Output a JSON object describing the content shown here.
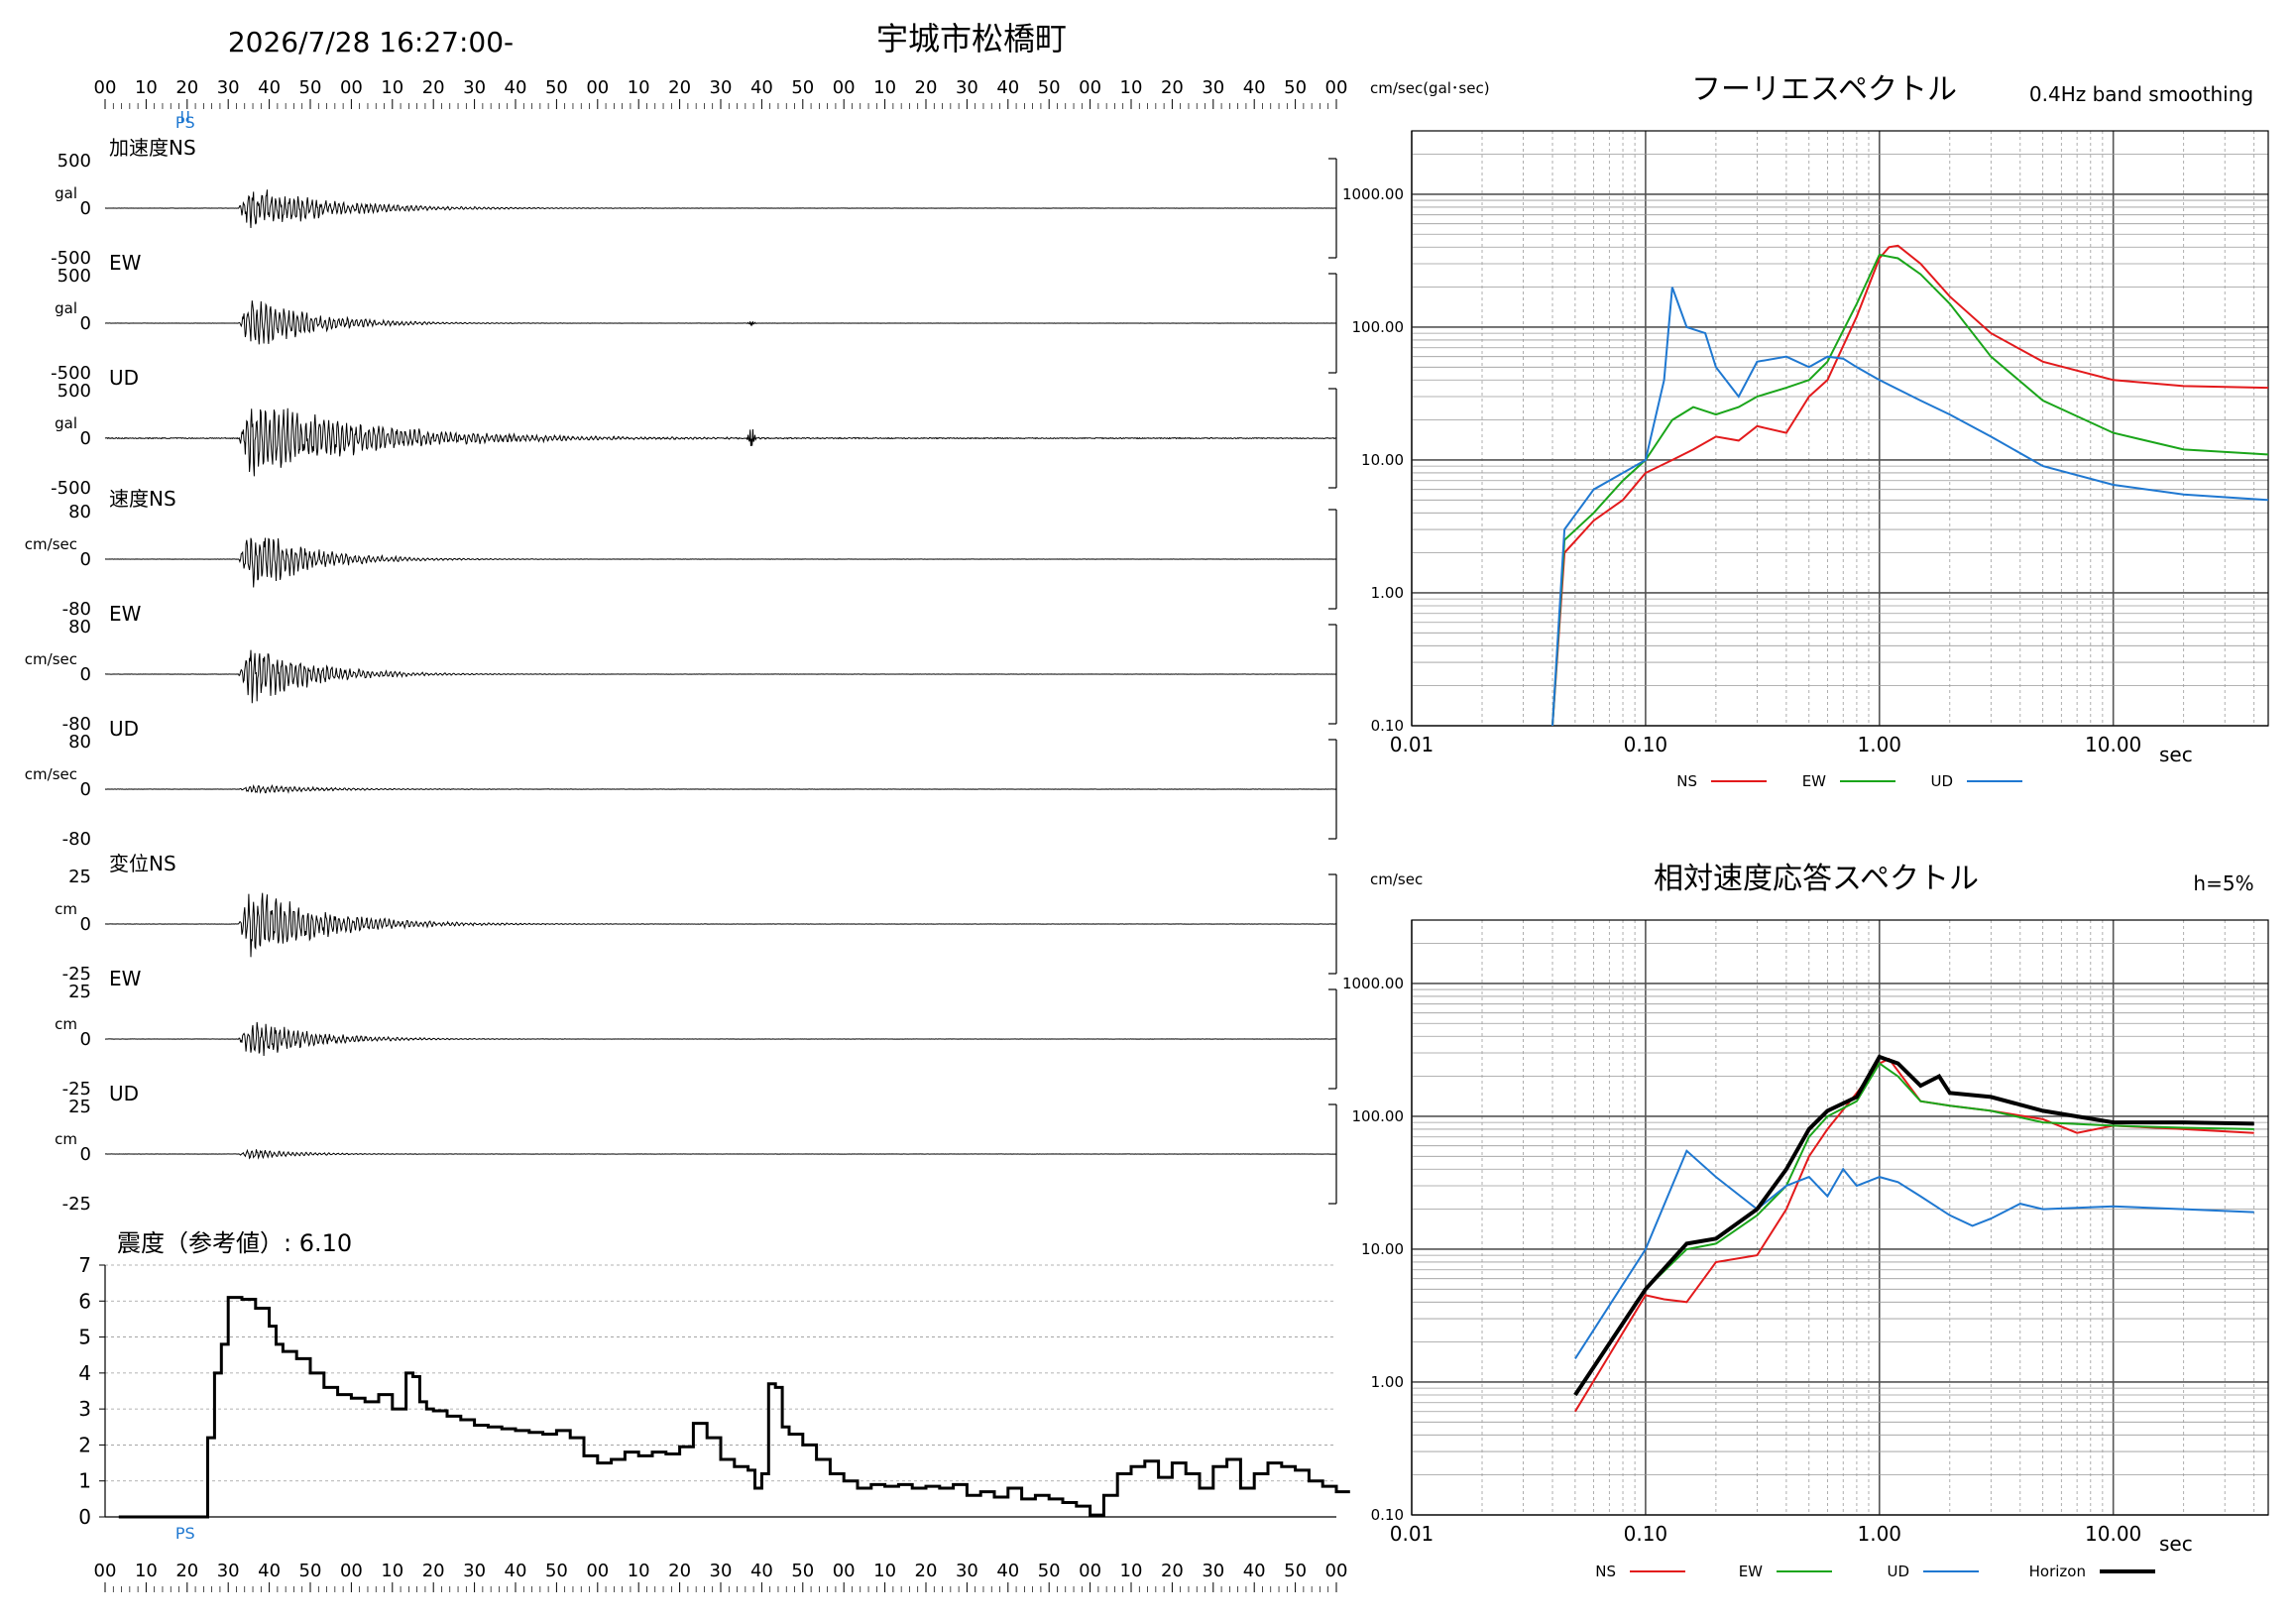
{
  "header": {
    "datetime": "2026/7/28 16:27:00-",
    "station": "宇城市松橋町"
  },
  "time_axis_labels": [
    "00",
    "10",
    "20",
    "30",
    "40",
    "50",
    "00",
    "10",
    "20",
    "30",
    "40",
    "50",
    "00",
    "10",
    "20",
    "30",
    "40",
    "50",
    "00",
    "10",
    "20",
    "30",
    "40",
    "50",
    "00",
    "10",
    "20",
    "30",
    "40",
    "50",
    "00"
  ],
  "ps_marker": "PS",
  "waveform_panels": [
    {
      "group": "加速度",
      "label": "加速度NS",
      "unit": "gal",
      "max": "500",
      "zero": "0",
      "min": "-500",
      "peak": 0.6,
      "decay": 0.09,
      "impulses": [],
      "noise": 0.004
    },
    {
      "group": "加速度",
      "label": "EW",
      "unit": "gal",
      "max": "500",
      "zero": "0",
      "min": "-500",
      "peak": 0.75,
      "decay": 0.12,
      "impulses": [
        [
          50,
          0.05
        ]
      ],
      "noise": 0.003
    },
    {
      "group": "加速度",
      "label": "UD",
      "unit": "gal",
      "max": "500",
      "zero": "0",
      "min": "-500",
      "peak": 0.9,
      "decay": 0.06,
      "impulses": [
        [
          50,
          0.25
        ]
      ],
      "noise": 0.02
    },
    {
      "group": "速度",
      "label": "速度NS",
      "unit": "cm/sec",
      "max": "80",
      "zero": "0",
      "min": "-80",
      "peak": 0.85,
      "decay": 0.12,
      "impulses": [],
      "noise": 0.004
    },
    {
      "group": "速度",
      "label": "EW",
      "unit": "cm/sec",
      "max": "80",
      "zero": "0",
      "min": "-80",
      "peak": 0.85,
      "decay": 0.12,
      "impulses": [],
      "noise": 0.004
    },
    {
      "group": "速度",
      "label": "UD",
      "unit": "cm/sec",
      "max": "80",
      "zero": "0",
      "min": "-80",
      "peak": 0.12,
      "decay": 0.1,
      "impulses": [],
      "noise": 0.006
    },
    {
      "group": "変位",
      "label": "変位NS",
      "unit": "cm",
      "max": "25",
      "zero": "0",
      "min": "-25",
      "peak": 0.95,
      "decay": 0.1,
      "impulses": [],
      "noise": 0.005
    },
    {
      "group": "変位",
      "label": "EW",
      "unit": "cm",
      "max": "25",
      "zero": "0",
      "min": "-25",
      "peak": 0.55,
      "decay": 0.12,
      "impulses": [],
      "noise": 0.004
    },
    {
      "group": "変位",
      "label": "UD",
      "unit": "cm",
      "max": "25",
      "zero": "0",
      "min": "-25",
      "peak": 0.15,
      "decay": 0.15,
      "impulses": [],
      "noise": 0.004
    }
  ],
  "intensity_panel": {
    "title": "震度（参考値）: 6.10",
    "yticks": [
      "7",
      "6",
      "5",
      "4",
      "3",
      "2",
      "1",
      "0"
    ]
  },
  "chart_data": [
    {
      "type": "line",
      "title": "",
      "ylabel": "",
      "xlabel": "",
      "ylim": [
        0,
        7
      ],
      "xlim": [
        0,
        180
      ],
      "series": [
        {
          "x": [
            0,
            6,
            12,
            13,
            14,
            15,
            16,
            17,
            18,
            20,
            22,
            23,
            24,
            26,
            28,
            30,
            32,
            34,
            36,
            38,
            40,
            42,
            43,
            44,
            45,
            46,
            48,
            50,
            52,
            54,
            56,
            58,
            60,
            62,
            64,
            66,
            68,
            70,
            72,
            74,
            76,
            78,
            80,
            82,
            84,
            86,
            88,
            90,
            92,
            93,
            94,
            95,
            96,
            97,
            98,
            100,
            102,
            104,
            106,
            108,
            110,
            112,
            114,
            116,
            118,
            120,
            122,
            124,
            126,
            128,
            130,
            132,
            134,
            136,
            138,
            140,
            142,
            144,
            146,
            148,
            150,
            152,
            154,
            156,
            158,
            160,
            162,
            164,
            166,
            168,
            170,
            172,
            174,
            176,
            178,
            180
          ],
          "y": [
            0,
            0,
            0,
            2.2,
            4.0,
            4.8,
            6.1,
            6.1,
            6.05,
            5.8,
            5.3,
            4.8,
            4.6,
            4.4,
            4.0,
            3.6,
            3.4,
            3.3,
            3.2,
            3.4,
            3.0,
            4.0,
            3.9,
            3.2,
            3.0,
            2.95,
            2.8,
            2.7,
            2.55,
            2.5,
            2.45,
            2.4,
            2.35,
            2.3,
            2.4,
            2.2,
            1.7,
            1.5,
            1.6,
            1.8,
            1.7,
            1.8,
            1.75,
            1.95,
            2.6,
            2.2,
            1.6,
            1.4,
            1.3,
            0.8,
            1.2,
            3.7,
            3.6,
            2.5,
            2.3,
            2.0,
            1.6,
            1.2,
            1.0,
            0.8,
            0.9,
            0.85,
            0.9,
            0.8,
            0.85,
            0.8,
            0.9,
            0.6,
            0.7,
            0.55,
            0.8,
            0.5,
            0.6,
            0.5,
            0.4,
            0.3,
            0.05,
            0.6,
            1.2,
            1.4,
            1.55,
            1.1,
            1.5,
            1.2,
            0.8,
            1.4,
            1.6,
            0.8,
            1.2,
            1.5,
            1.4,
            1.3,
            1.0,
            0.85,
            0.7,
            0.7
          ]
        }
      ]
    },
    {
      "type": "line",
      "title": "フーリエスペクトル",
      "subtitle": "0.4Hz band smoothing",
      "ylabel": "cm/sec(gal･sec)",
      "xlabel": "sec",
      "xscale": "log",
      "yscale": "log",
      "xlim": [
        0.01,
        46
      ],
      "ylim": [
        0.1,
        3000
      ],
      "x_ticks": [
        "0.01",
        "0.10",
        "1.00",
        "10.00"
      ],
      "y_ticks": [
        "0.10",
        "1.00",
        "10.00",
        "100.00",
        "1000.00"
      ],
      "legend_position": "bottom",
      "series": [
        {
          "name": "NS",
          "color": "#e31a1c",
          "x": [
            0.04,
            0.045,
            0.06,
            0.08,
            0.1,
            0.13,
            0.16,
            0.2,
            0.25,
            0.3,
            0.4,
            0.5,
            0.6,
            0.8,
            1.0,
            1.1,
            1.2,
            1.5,
            2,
            3,
            5,
            10,
            20,
            46
          ],
          "y": [
            0.1,
            2,
            3.5,
            5,
            8,
            10,
            12,
            15,
            14,
            18,
            16,
            30,
            40,
            120,
            330,
            400,
            410,
            300,
            170,
            90,
            55,
            40,
            36,
            35
          ]
        },
        {
          "name": "EW",
          "color": "#1aa51a",
          "x": [
            0.04,
            0.045,
            0.06,
            0.08,
            0.1,
            0.13,
            0.16,
            0.2,
            0.25,
            0.3,
            0.4,
            0.5,
            0.6,
            0.8,
            1.0,
            1.2,
            1.5,
            2,
            3,
            5,
            10,
            20,
            46
          ],
          "y": [
            0.1,
            2.5,
            4,
            7,
            10,
            20,
            25,
            22,
            25,
            30,
            35,
            40,
            55,
            150,
            350,
            330,
            250,
            150,
            60,
            28,
            16,
            12,
            11
          ]
        },
        {
          "name": "UD",
          "color": "#1f78d1",
          "x": [
            0.04,
            0.045,
            0.06,
            0.08,
            0.1,
            0.12,
            0.13,
            0.15,
            0.18,
            0.2,
            0.25,
            0.3,
            0.4,
            0.5,
            0.6,
            0.7,
            0.8,
            1.0,
            1.5,
            2,
            3,
            5,
            10,
            20,
            46
          ],
          "y": [
            0.1,
            3,
            6,
            8,
            10,
            40,
            200,
            100,
            90,
            50,
            30,
            55,
            60,
            50,
            60,
            58,
            50,
            40,
            28,
            22,
            15,
            9,
            6.5,
            5.5,
            5
          ]
        }
      ]
    },
    {
      "type": "line",
      "title": "相対速度応答スペクトル",
      "subtitle": "h=5%",
      "ylabel": "cm/sec",
      "xlabel": "sec",
      "xscale": "log",
      "yscale": "log",
      "xlim": [
        0.01,
        46
      ],
      "ylim": [
        0.1,
        3000
      ],
      "x_ticks": [
        "0.01",
        "0.10",
        "1.00",
        "10.00"
      ],
      "y_ticks": [
        "0.10",
        "1.00",
        "10.00",
        "100.00",
        "1000.00"
      ],
      "legend_position": "bottom",
      "series": [
        {
          "name": "NS",
          "color": "#e31a1c",
          "x": [
            0.05,
            0.1,
            0.12,
            0.15,
            0.2,
            0.3,
            0.4,
            0.5,
            0.6,
            0.8,
            1.0,
            1.1,
            1.2,
            1.5,
            2,
            3,
            5,
            7,
            10,
            20,
            40
          ],
          "y": [
            0.6,
            4.5,
            4.2,
            4,
            8,
            9,
            20,
            50,
            80,
            150,
            250,
            270,
            220,
            130,
            120,
            110,
            95,
            75,
            85,
            80,
            75
          ]
        },
        {
          "name": "EW",
          "color": "#1aa51a",
          "x": [
            0.05,
            0.1,
            0.15,
            0.2,
            0.3,
            0.4,
            0.5,
            0.6,
            0.8,
            1.0,
            1.2,
            1.5,
            2,
            3,
            5,
            10,
            20,
            40
          ],
          "y": [
            0.8,
            5,
            10,
            11,
            18,
            30,
            70,
            100,
            130,
            250,
            200,
            130,
            120,
            110,
            90,
            85,
            82,
            80
          ]
        },
        {
          "name": "UD",
          "color": "#1f78d1",
          "x": [
            0.05,
            0.1,
            0.15,
            0.2,
            0.3,
            0.4,
            0.5,
            0.6,
            0.7,
            0.8,
            1.0,
            1.2,
            1.5,
            2,
            2.5,
            3,
            4,
            5,
            10,
            20,
            40
          ],
          "y": [
            1.5,
            10,
            55,
            35,
            20,
            30,
            35,
            25,
            40,
            30,
            35,
            32,
            25,
            18,
            15,
            17,
            22,
            20,
            21,
            20,
            19
          ]
        },
        {
          "name": "Horizon",
          "color": "#000000",
          "x": [
            0.05,
            0.1,
            0.15,
            0.2,
            0.3,
            0.4,
            0.5,
            0.6,
            0.8,
            1.0,
            1.2,
            1.5,
            1.8,
            2,
            3,
            5,
            10,
            20,
            40
          ],
          "y": [
            0.8,
            5,
            11,
            12,
            20,
            40,
            80,
            110,
            140,
            280,
            250,
            170,
            200,
            150,
            140,
            110,
            90,
            90,
            88
          ]
        }
      ]
    }
  ]
}
